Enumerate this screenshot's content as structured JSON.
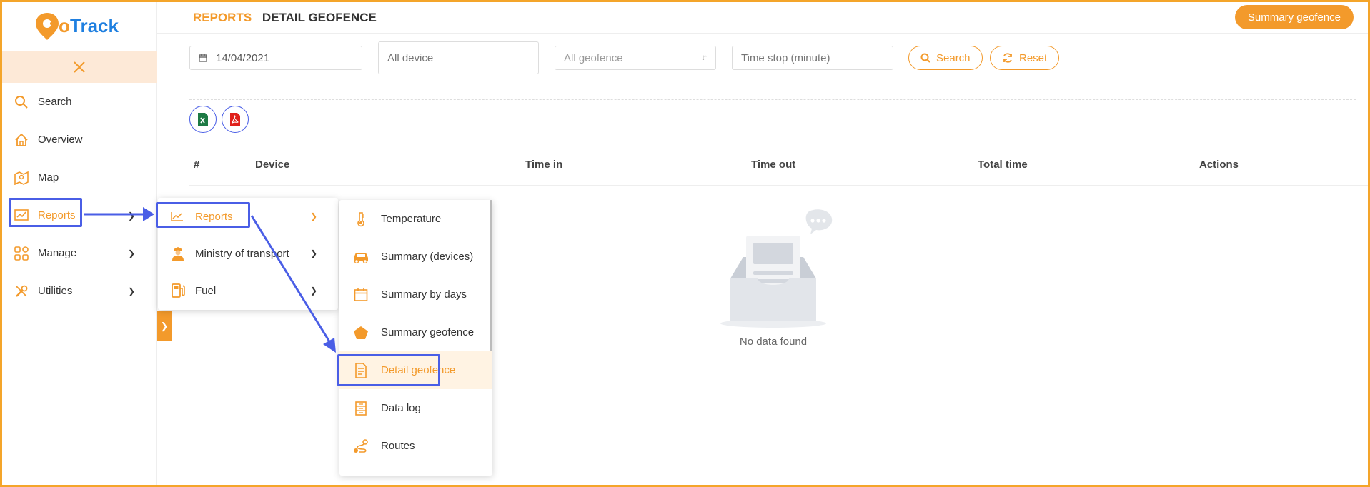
{
  "brand": {
    "logo_text": "GoTrack"
  },
  "sidebar": {
    "items": [
      {
        "label": "Search",
        "icon": "search-icon"
      },
      {
        "label": "Overview",
        "icon": "home-icon"
      },
      {
        "label": "Map",
        "icon": "map-icon"
      },
      {
        "label": "Reports",
        "icon": "chart-icon"
      },
      {
        "label": "Manage",
        "icon": "grid-icon"
      },
      {
        "label": "Utilities",
        "icon": "tools-icon"
      }
    ]
  },
  "header": {
    "breadcrumb_section": "REPORTS",
    "breadcrumb_page": "DETAIL GEOFENCE",
    "summary_button": "Summary geofence"
  },
  "filters": {
    "date": "14/04/2021",
    "device_placeholder": "All device",
    "geofence_placeholder": "All geofence",
    "timestop_placeholder": "Time stop (minute)",
    "search_label": "Search",
    "reset_label": "Reset"
  },
  "table": {
    "columns": [
      "#",
      "Device",
      "Time in",
      "Time out",
      "Total time",
      "Actions"
    ],
    "empty_text": "No data found"
  },
  "submenu_reports": {
    "items": [
      {
        "label": "Reports",
        "icon": "chart-icon"
      },
      {
        "label": "Ministry of transport",
        "icon": "officer-icon"
      },
      {
        "label": "Fuel",
        "icon": "fuel-icon"
      }
    ]
  },
  "submenu_types": {
    "items": [
      {
        "label": "Temperature",
        "icon": "thermometer-icon"
      },
      {
        "label": "Summary (devices)",
        "icon": "car-icon"
      },
      {
        "label": "Summary by days",
        "icon": "calendar-icon"
      },
      {
        "label": "Summary geofence",
        "icon": "pentagon-icon"
      },
      {
        "label": "Detail geofence",
        "icon": "document-icon"
      },
      {
        "label": "Data log",
        "icon": "datalog-icon"
      },
      {
        "label": "Routes",
        "icon": "route-icon"
      }
    ]
  },
  "colors": {
    "accent": "#f39a2b",
    "highlight": "#4a5ee6",
    "frame": "#f4a52a"
  }
}
